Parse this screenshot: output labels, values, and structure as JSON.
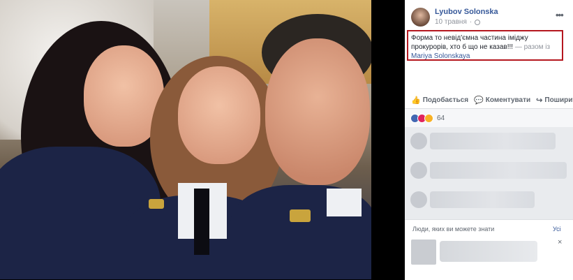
{
  "post": {
    "author": "Lyubov Solonska",
    "date": "10 травня",
    "text_main": "Форма то невід'ємна частина іміджу прокурорів, хто б що не казав!!!",
    "text_with": "— разом із",
    "tagged": "Mariya Solonskaya",
    "more": "•••"
  },
  "actions": {
    "like": "Подобається",
    "comment": "Коментувати",
    "share": "Поширити"
  },
  "reactions": {
    "count": "64"
  },
  "pymk": {
    "title": "Люди, яких ви можете знати",
    "all": "Усі",
    "close": "×"
  },
  "icons": {
    "like": "thumbs-up-icon",
    "comment": "comment-icon",
    "share": "share-icon",
    "privacy": "globe-icon",
    "more": "more-options-icon"
  },
  "colors": {
    "link": "#365899",
    "highlight_border": "#b5171f",
    "muted": "#90949c"
  }
}
